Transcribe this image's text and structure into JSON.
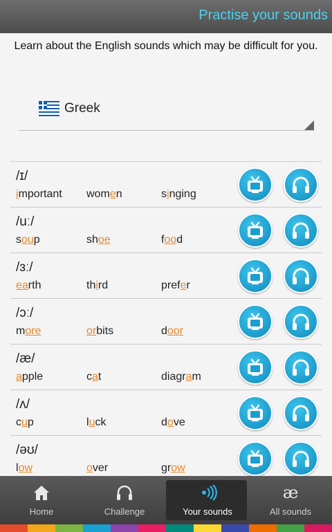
{
  "header": {
    "title": "Practise your sounds"
  },
  "intro": "Learn about the English sounds which may be difficult for you.",
  "language": {
    "name": "Greek",
    "flag_icon": "greece-flag-icon"
  },
  "sounds": [
    {
      "symbol": "/ɪ/",
      "words": [
        {
          "pre": "",
          "hl": "i",
          "post": "mportant"
        },
        {
          "pre": "wom",
          "hl": "e",
          "post": "n"
        },
        {
          "pre": "s",
          "hl": "i",
          "post": "nging"
        }
      ]
    },
    {
      "symbol": "/uː/",
      "words": [
        {
          "pre": "s",
          "hl": "ou",
          "post": "p"
        },
        {
          "pre": "sh",
          "hl": "oe",
          "post": ""
        },
        {
          "pre": "f",
          "hl": "oo",
          "post": "d"
        }
      ]
    },
    {
      "symbol": "/ɜː/",
      "words": [
        {
          "pre": "",
          "hl": "ea",
          "post": "rth"
        },
        {
          "pre": "th",
          "hl": "i",
          "post": "rd"
        },
        {
          "pre": "pref",
          "hl": "e",
          "post": "r"
        }
      ]
    },
    {
      "symbol": "/ɔː/",
      "words": [
        {
          "pre": "m",
          "hl": "ore",
          "post": ""
        },
        {
          "pre": "",
          "hl": "or",
          "post": "bits"
        },
        {
          "pre": "d",
          "hl": "oor",
          "post": ""
        }
      ]
    },
    {
      "symbol": "/æ/",
      "words": [
        {
          "pre": "",
          "hl": "a",
          "post": "pple"
        },
        {
          "pre": "c",
          "hl": "a",
          "post": "t"
        },
        {
          "pre": "diagr",
          "hl": "a",
          "post": "m"
        }
      ]
    },
    {
      "symbol": "/ʌ/",
      "words": [
        {
          "pre": "c",
          "hl": "u",
          "post": "p"
        },
        {
          "pre": "l",
          "hl": "u",
          "post": "ck"
        },
        {
          "pre": "d",
          "hl": "o",
          "post": "ve"
        }
      ]
    },
    {
      "symbol": "/əʊ/",
      "words": [
        {
          "pre": "l",
          "hl": "ow",
          "post": ""
        },
        {
          "pre": "",
          "hl": "o",
          "post": "ver"
        },
        {
          "pre": "gr",
          "hl": "ow",
          "post": ""
        }
      ]
    }
  ],
  "row_buttons": {
    "video_icon": "tv-icon",
    "audio_icon": "headphones-icon"
  },
  "tabs": [
    {
      "label": "Home",
      "icon": "home-icon",
      "active": false
    },
    {
      "label": "Challenge",
      "icon": "headphones-icon",
      "active": false
    },
    {
      "label": "Your sounds",
      "icon": "sound-waves-icon",
      "active": true
    },
    {
      "label": "All sounds",
      "icon": "ae-icon",
      "active": false
    }
  ],
  "colors": {
    "accent": "#4fd1ef",
    "highlight": "#e8872b",
    "button": "#1a9fd0",
    "strip": [
      "#e44b2a",
      "#f2a71b",
      "#7cb342",
      "#1a9fd0",
      "#8e44ad",
      "#e91e63",
      "#00897b",
      "#fdd835",
      "#3949ab",
      "#ef6c00",
      "#43a047",
      "#d81b60"
    ]
  }
}
